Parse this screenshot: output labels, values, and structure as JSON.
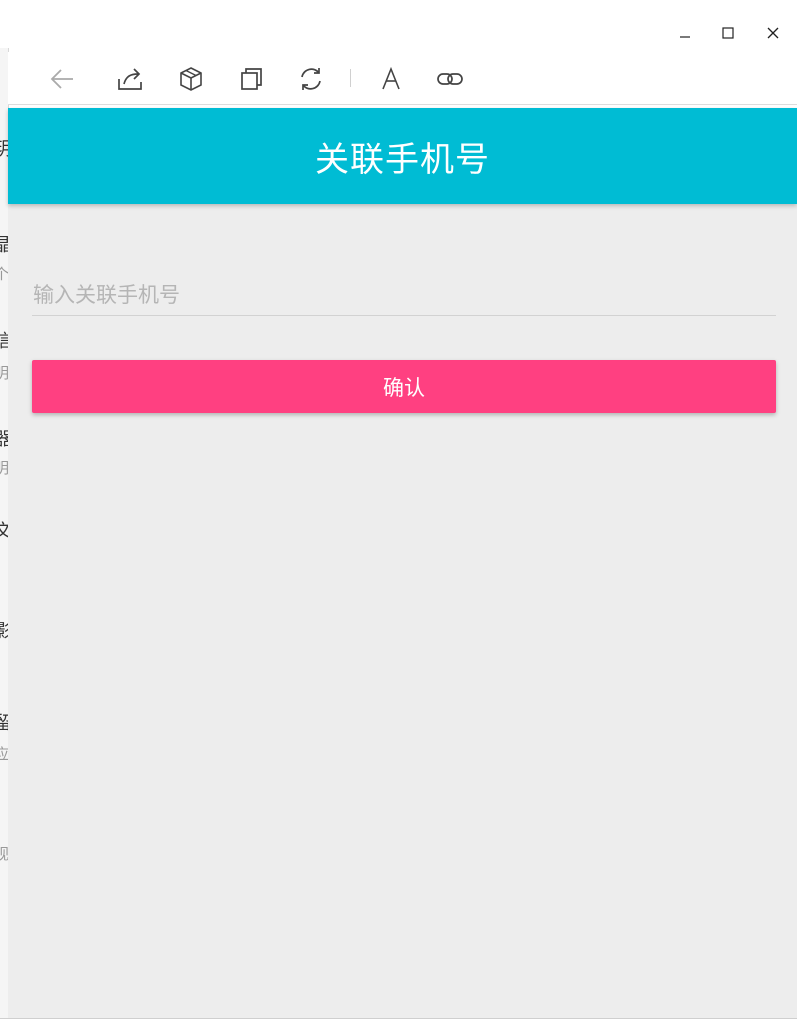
{
  "window": {
    "controls": {
      "minimize": "minimize-icon",
      "maximize": "maximize-icon",
      "close": "close-icon"
    }
  },
  "toolbar": {
    "icons": [
      "back-arrow-icon",
      "share-icon",
      "cube-icon",
      "copy-icon",
      "refresh-icon",
      "font-icon",
      "link-icon"
    ],
    "font_glyph": "A"
  },
  "appbar": {
    "title": "关联手机号",
    "color": "#00bcd4"
  },
  "form": {
    "phone_placeholder": "输入关联手机号",
    "phone_value": "",
    "confirm_label": "确认",
    "confirm_color": "#ff4081"
  },
  "background_fragments": [
    "玥",
    "晶",
    "个",
    "信",
    "明",
    "器",
    "明",
    "文",
    "影",
    "留",
    "应",
    "视"
  ]
}
